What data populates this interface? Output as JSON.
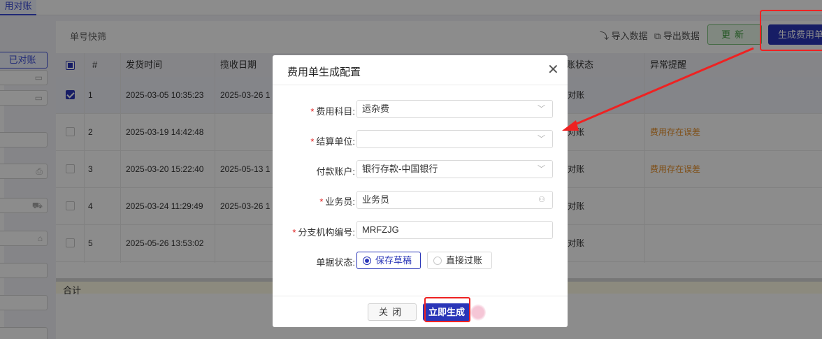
{
  "topbar": {
    "tab_label": "用对账"
  },
  "left": {
    "checked_button": "已对账",
    "filter_icons": [
      "calendar-icon",
      "calendar-icon",
      "",
      "",
      "printer-icon",
      "truck-icon",
      "home-icon",
      "",
      "",
      ""
    ]
  },
  "toolbar": {
    "title": "单号快筛",
    "import_label": "导入数据",
    "export_label": "导出数据",
    "update_label": "更新",
    "generate_label": "生成费用单"
  },
  "table": {
    "headers": {
      "index": "#",
      "ship_time": "发货时间",
      "pickup_date": "揽收日期",
      "status": "账状态",
      "alert": "异常提醒"
    },
    "rows": [
      {
        "checked": true,
        "index": "1",
        "ship_time": "2025-03-05 10:35:23",
        "pickup_date": "2025-03-26 1",
        "status": "对账",
        "alert": ""
      },
      {
        "checked": false,
        "index": "2",
        "ship_time": "2025-03-19 14:42:48",
        "pickup_date": "",
        "status": "对账",
        "alert": "费用存在误差"
      },
      {
        "checked": false,
        "index": "3",
        "ship_time": "2025-03-20 15:22:40",
        "pickup_date": "2025-05-13 1",
        "status": "对账",
        "alert": "费用存在误差"
      },
      {
        "checked": false,
        "index": "4",
        "ship_time": "2025-03-24 11:29:49",
        "pickup_date": "2025-03-26 1",
        "status": "对账",
        "alert": ""
      },
      {
        "checked": false,
        "index": "5",
        "ship_time": "2025-05-26 13:53:02",
        "pickup_date": "",
        "status": "对账",
        "alert": ""
      }
    ],
    "sum_label": "合计"
  },
  "dialog": {
    "title": "费用单生成配置",
    "fields": {
      "expense_subject": {
        "label": "费用科目:",
        "value": "运杂费",
        "required": true
      },
      "settle_unit": {
        "label": "结算单位:",
        "value": "",
        "required": true
      },
      "pay_account": {
        "label": "付款账户:",
        "value": "银行存款-中国银行",
        "required": false
      },
      "salesman": {
        "label": "业务员:",
        "value": "业务员",
        "required": true
      },
      "branch_code": {
        "label": "分支机构编号:",
        "value": "MRFZJG",
        "required": true
      }
    },
    "doc_status_label": "单据状态:",
    "radio_draft": "保存草稿",
    "radio_post": "直接过账",
    "close_button": "关闭",
    "generate_button": "立即生成",
    "required_mark": "*"
  },
  "colors": {
    "primary": "#2a36b8",
    "highlight": "#ee2222",
    "warning": "#e8912b",
    "success": "#3a9a3a"
  }
}
